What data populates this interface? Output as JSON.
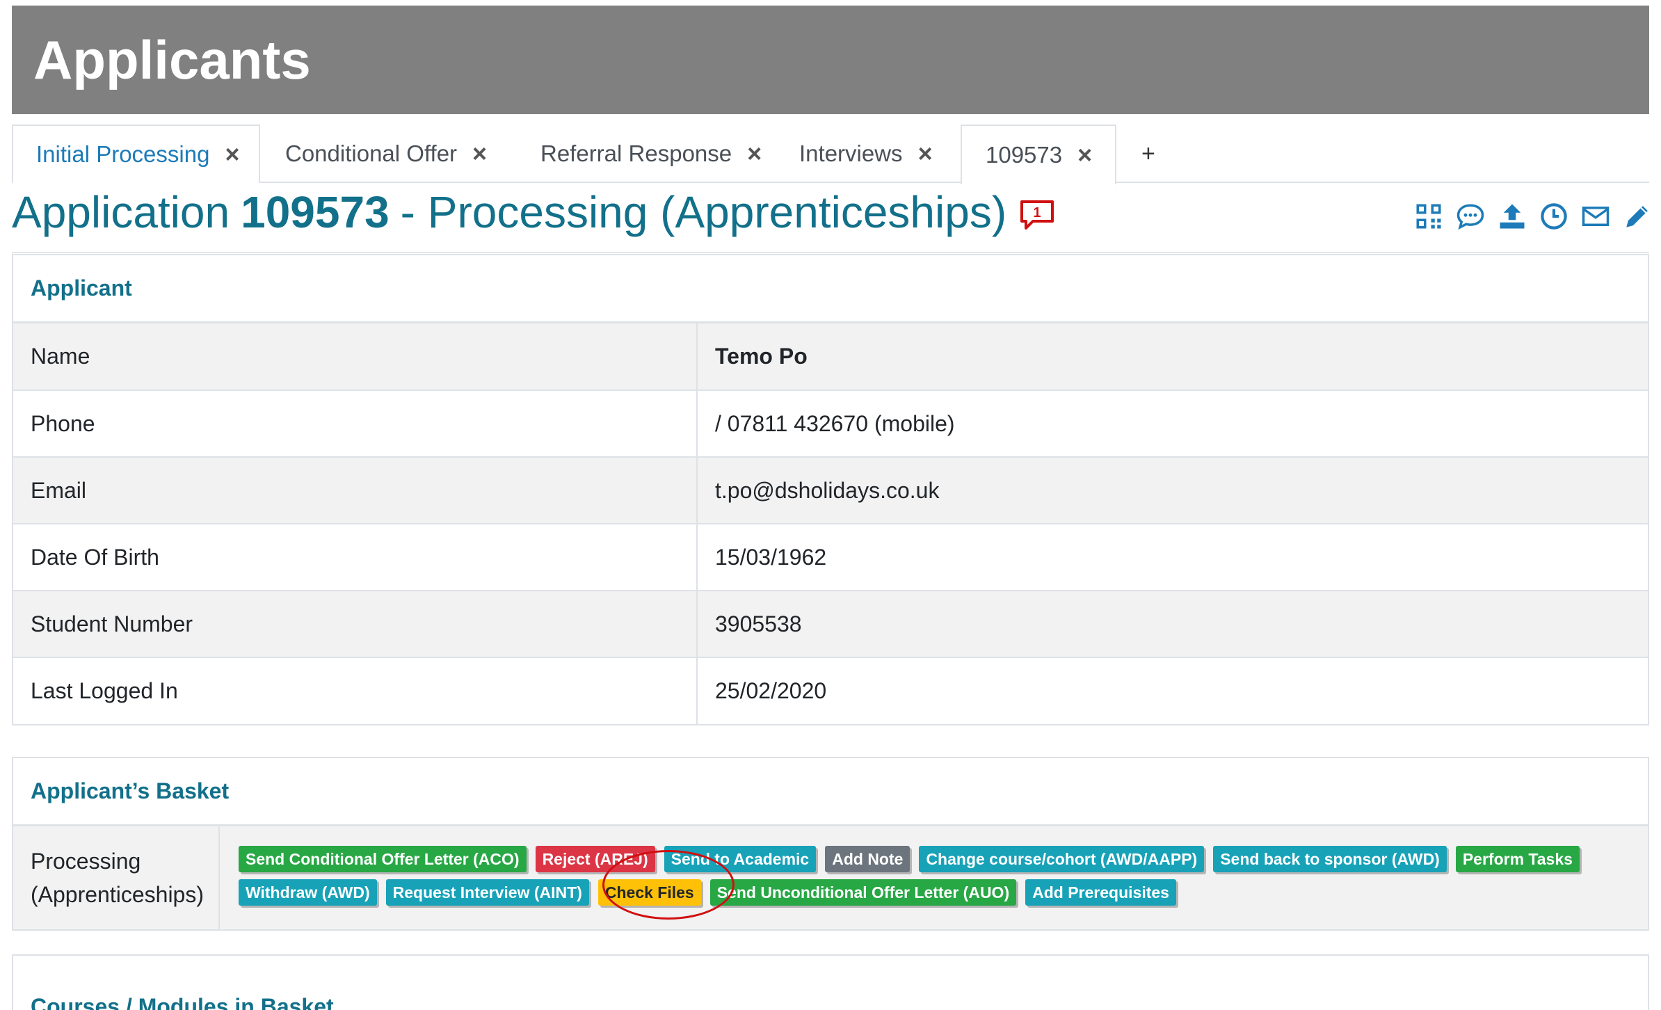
{
  "header": {
    "title": "Applicants"
  },
  "tabs": [
    {
      "label": "Initial Processing",
      "close": "×"
    },
    {
      "label": "Conditional Offer",
      "close": "×"
    },
    {
      "label": "Referral Response",
      "close": "×"
    },
    {
      "label": "Interviews",
      "close": "×"
    },
    {
      "label": "109573",
      "close": "×"
    },
    {
      "label": "+"
    }
  ],
  "page_title": {
    "prefix": "Application",
    "number": "109573",
    "suffix": "- Processing (Apprenticeships)",
    "notification_count": "1"
  },
  "toolbar_icons": [
    "qr-code-icon",
    "comments-icon",
    "upload-icon",
    "clock-icon",
    "envelope-icon",
    "pencil-icon"
  ],
  "applicant": {
    "heading": "Applicant",
    "rows": [
      {
        "label": "Name",
        "value": "Temo Po"
      },
      {
        "label": "Phone",
        "value": "/ 07811 432670 (mobile)"
      },
      {
        "label": "Email",
        "value": "t.po@dsholidays.co.uk"
      },
      {
        "label": "Date Of Birth",
        "value": "15/03/1962"
      },
      {
        "label": "Student Number",
        "value": "3905538"
      },
      {
        "label": "Last Logged In",
        "value": "25/02/2020"
      }
    ]
  },
  "basket": {
    "heading": "Applicant’s Basket",
    "row_label_line1": "Processing",
    "row_label_line2": "(Apprenticeships)",
    "actions": [
      {
        "label": "Send Conditional Offer Letter (ACO)",
        "color": "#28a745"
      },
      {
        "label": "Reject (AREJ)",
        "color": "#dc3545"
      },
      {
        "label": "Send to Academic",
        "color": "#17a2b8"
      },
      {
        "label": "Add Note",
        "color": "#6c757d"
      },
      {
        "label": "Change course/cohort (AWD/AAPP)",
        "color": "#17a2b8"
      },
      {
        "label": "Send back to sponsor (AWD)",
        "color": "#17a2b8"
      },
      {
        "label": "Perform Tasks",
        "color": "#28a745"
      },
      {
        "label": "Withdraw (AWD)",
        "color": "#17a2b8"
      },
      {
        "label": "Request Interview (AINT)",
        "color": "#17a2b8"
      },
      {
        "label": "Check Files",
        "color": "#ffc107"
      },
      {
        "label": "Send Unconditional Offer Letter (AUO)",
        "color": "#28a745"
      },
      {
        "label": "Add Prerequisites",
        "color": "#17a2b8"
      }
    ]
  },
  "courses": {
    "heading": "Courses / Modules in Basket"
  }
}
